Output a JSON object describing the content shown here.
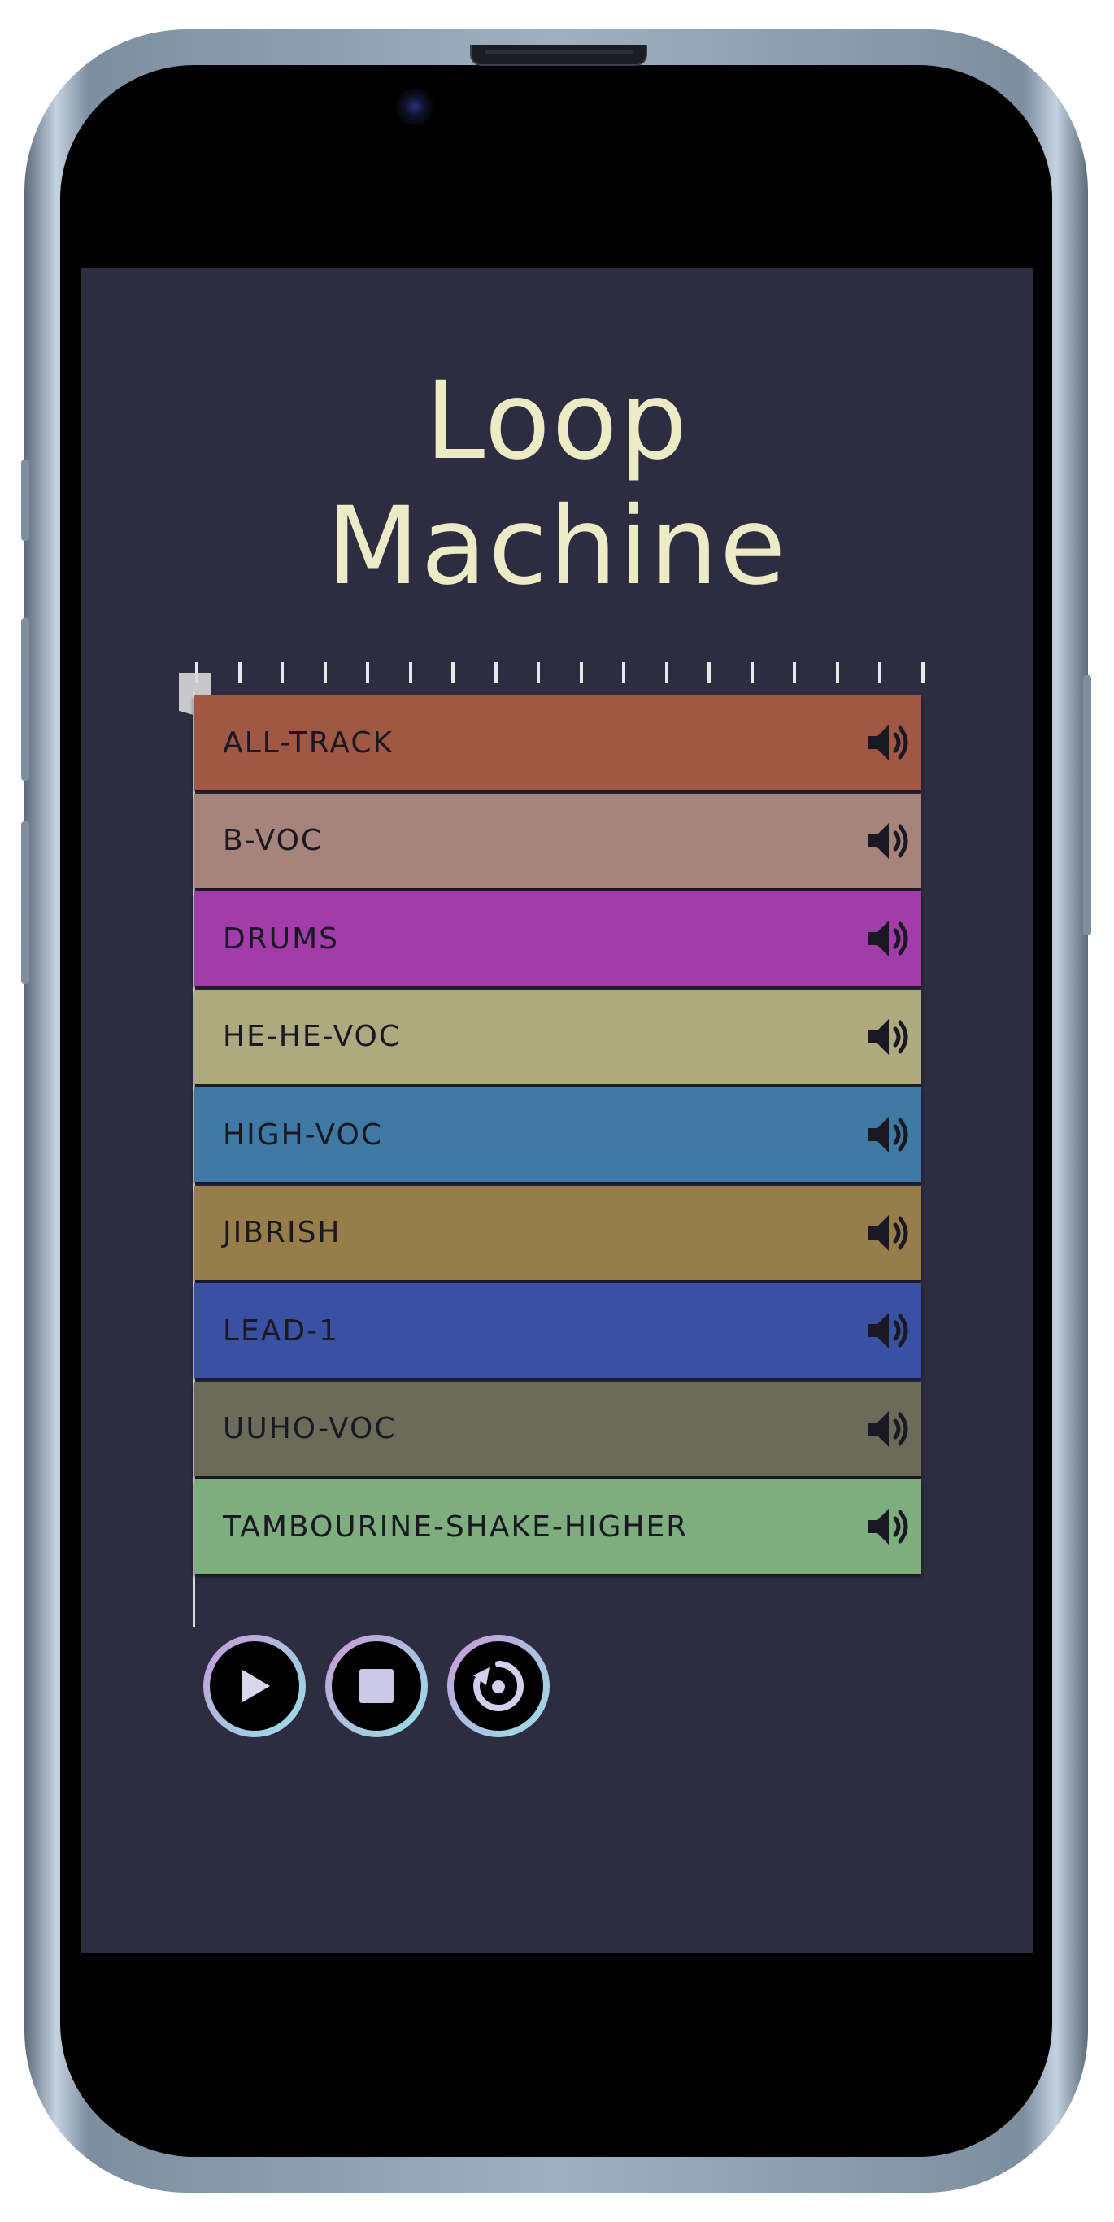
{
  "app": {
    "title_line1": "Loop",
    "title_line2": "Machine"
  },
  "tracks": [
    {
      "label": "ALL-TRACK",
      "color": "#a05844",
      "icon": "speaker-volume-icon"
    },
    {
      "label": "B-VOC",
      "color": "#a6837b",
      "icon": "speaker-volume-icon"
    },
    {
      "label": "DRUMS",
      "color": "#a13caa",
      "icon": "speaker-volume-icon"
    },
    {
      "label": "HE-HE-VOC",
      "color": "#aeaa80",
      "icon": "speaker-volume-icon"
    },
    {
      "label": "HIGH-VOC",
      "color": "#3f7aa4",
      "icon": "speaker-volume-icon"
    },
    {
      "label": "JIBRISH",
      "color": "#967d4a",
      "icon": "speaker-volume-icon"
    },
    {
      "label": "LEAD-1",
      "color": "#3a50a2",
      "icon": "speaker-volume-icon"
    },
    {
      "label": "UUHO-VOC",
      "color": "#6b6b59",
      "icon": "speaker-volume-icon"
    },
    {
      "label": "TAMBOURINE-SHAKE-HIGHER",
      "color": "#7ead7e",
      "icon": "speaker-volume-icon"
    }
  ],
  "controls": [
    {
      "name": "play",
      "icon": "play-icon"
    },
    {
      "name": "stop",
      "icon": "stop-icon"
    },
    {
      "name": "loop",
      "icon": "loop-icon"
    }
  ],
  "colors": {
    "background": "#2e2c40",
    "title": "#ebebc6",
    "track_text": "#1a1823"
  }
}
